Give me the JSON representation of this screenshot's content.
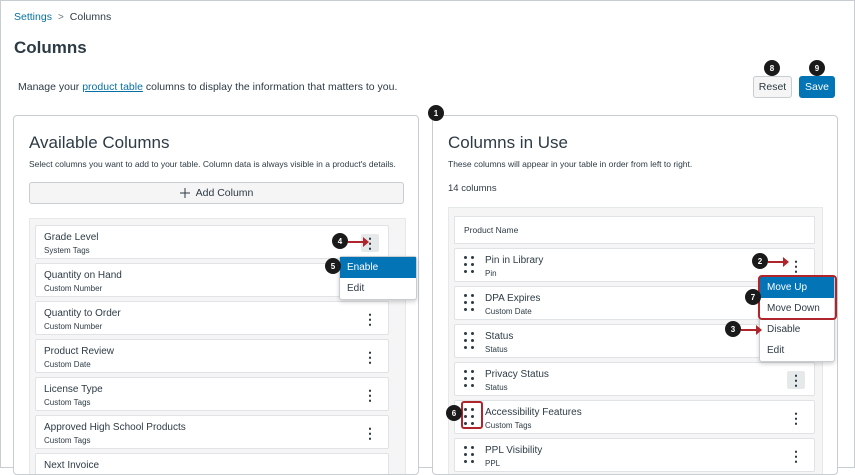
{
  "breadcrumb": {
    "parent": "Settings",
    "separator": ">",
    "current": "Columns"
  },
  "page": {
    "title": "Columns",
    "intro_prefix": "Manage your ",
    "intro_link": "product table",
    "intro_suffix": " columns to display the information that matters to you."
  },
  "actions": {
    "reset_label": "Reset",
    "save_label": "Save"
  },
  "available": {
    "title": "Available Columns",
    "subtitle": "Select columns you want to add to your table. Column data is always visible in a product's details.",
    "add_label": "Add Column",
    "items": [
      {
        "name": "Grade Level",
        "type": "System Tags"
      },
      {
        "name": "Quantity on Hand",
        "type": "Custom Number"
      },
      {
        "name": "Quantity to Order",
        "type": "Custom Number"
      },
      {
        "name": "Product Review",
        "type": "Custom Date"
      },
      {
        "name": "License Type",
        "type": "Custom Tags"
      },
      {
        "name": "Approved High School Products",
        "type": "Custom Tags"
      },
      {
        "name": "Next Invoice",
        "type": ""
      }
    ],
    "menu": {
      "items": [
        "Enable",
        "Edit"
      ]
    }
  },
  "in_use": {
    "title": "Columns in Use",
    "subtitle": "These columns will appear in your table in order from left to right.",
    "count": "14 columns",
    "fixed_column": "Product Name",
    "items": [
      {
        "name": "Pin in Library",
        "type": "Pin"
      },
      {
        "name": "DPA Expires",
        "type": "Custom Date"
      },
      {
        "name": "Status",
        "type": "Status"
      },
      {
        "name": "Privacy Status",
        "type": "Status"
      },
      {
        "name": "Accessibility Features",
        "type": "Custom Tags"
      },
      {
        "name": "PPL Visibility",
        "type": "PPL"
      }
    ],
    "menu": {
      "items": [
        "Move Up",
        "Move Down",
        "Disable",
        "Edit"
      ]
    }
  },
  "callouts": [
    "1",
    "2",
    "3",
    "4",
    "5",
    "6",
    "7",
    "8",
    "9"
  ],
  "icons": {
    "kebab": "vertical-ellipsis",
    "drag": "drag-handle",
    "add": "plus-icon"
  },
  "colors": {
    "accent": "#0374b5",
    "callout_red": "#b0242b",
    "link": "#0770a3"
  }
}
